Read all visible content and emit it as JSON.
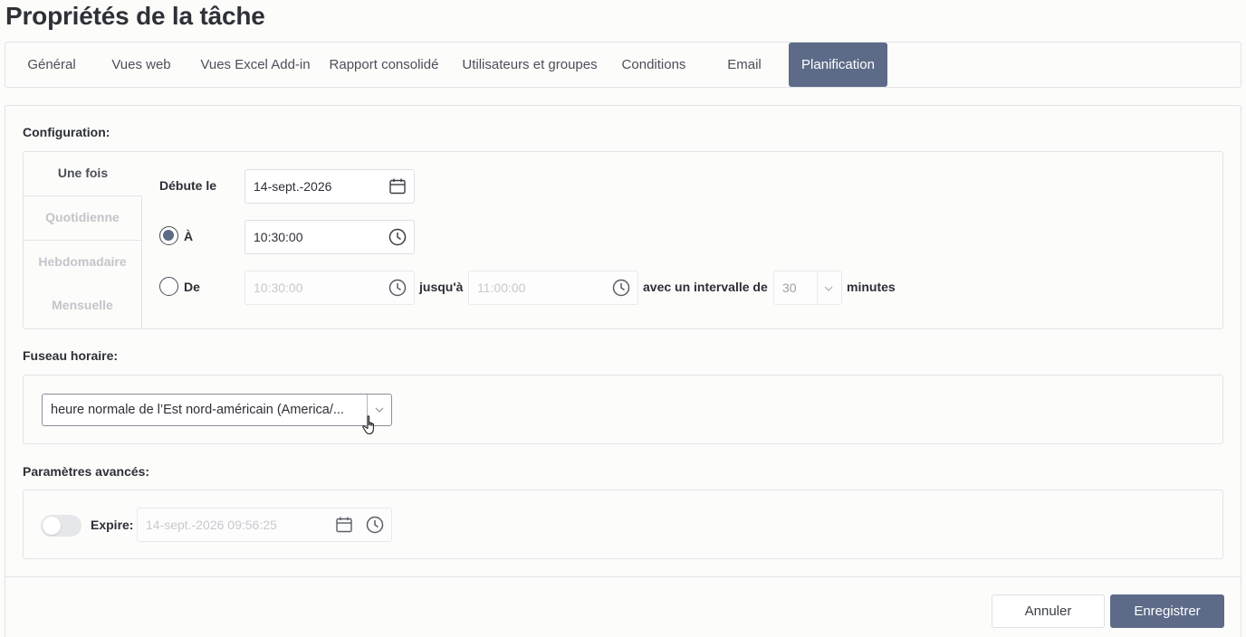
{
  "page": {
    "title": "Propriétés de la tâche"
  },
  "tabs": [
    {
      "label": "Général",
      "active": false
    },
    {
      "label": "Vues web",
      "active": false
    },
    {
      "label": "Vues Excel Add-in",
      "active": false
    },
    {
      "label": "Rapport consolidé",
      "active": false
    },
    {
      "label": "Utilisateurs et groupes",
      "active": false
    },
    {
      "label": "Conditions",
      "active": false
    },
    {
      "label": "Email",
      "active": false
    },
    {
      "label": "Planification",
      "active": true
    }
  ],
  "configuration": {
    "label": "Configuration:",
    "frequency_tabs": [
      {
        "label": "Une fois",
        "active": true
      },
      {
        "label": "Quotidienne",
        "active": false
      },
      {
        "label": "Hebdomadaire",
        "active": false
      },
      {
        "label": "Mensuelle",
        "active": false
      }
    ],
    "start_label": "Débute le",
    "start_date": "14-sept.-2026",
    "at_label": "À",
    "at_selected": true,
    "at_time": "10:30:00",
    "from_label": "De",
    "from_selected": false,
    "from_time": "10:30:00",
    "until_label": "jusqu'à",
    "until_time": "11:00:00",
    "interval_label": "avec un intervalle de",
    "interval_value": "30",
    "minutes_label": "minutes"
  },
  "timezone": {
    "label": "Fuseau horaire:",
    "value": "heure normale de l’Est nord-américain (America/..."
  },
  "advanced": {
    "label": "Paramètres avancés:",
    "expire_label": "Expire:",
    "expire_enabled": false,
    "expire_value": "14-sept.-2026 09:56:25"
  },
  "footer": {
    "cancel_label": "Annuler",
    "save_label": "Enregistrer"
  },
  "colors": {
    "accent": "#5d6b88",
    "border": "#e2e3e6",
    "disabled_text": "#c7c9ce"
  }
}
